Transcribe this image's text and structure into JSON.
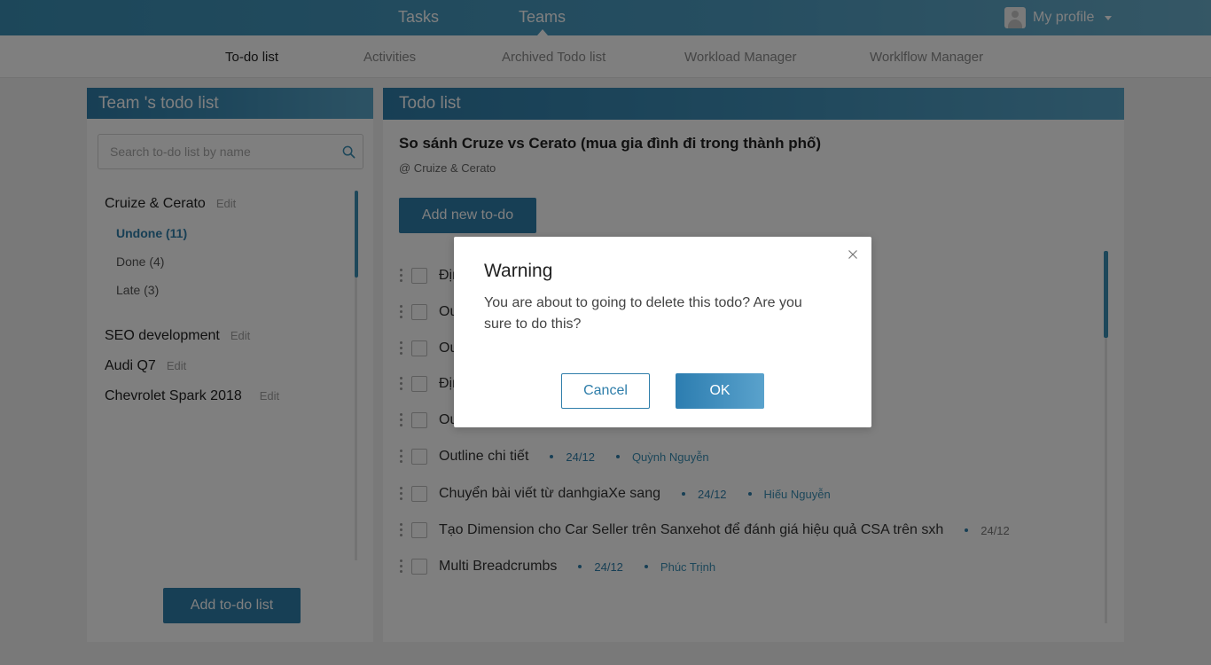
{
  "topbar": {
    "nav": [
      "Tasks",
      "Teams"
    ],
    "active": "Teams",
    "profile_label": "My profile"
  },
  "subnav": {
    "items": [
      "To-do list",
      "Activities",
      "Archived Todo list",
      "Workload Manager",
      "Worklflow Manager"
    ],
    "active": "To-do list"
  },
  "left_panel": {
    "header": "Team 's todo list",
    "search_placeholder": "Search to-do list by name",
    "groups": [
      {
        "name": "Cruize & Cerato",
        "edit": "Edit"
      },
      {
        "name": "SEO development",
        "edit": "Edit"
      },
      {
        "name": "Audi Q7",
        "edit": "Edit"
      },
      {
        "name": "Chevrolet Spark 2018",
        "edit": "Edit"
      }
    ],
    "filters": [
      "Undone (11)",
      "Done (4)",
      "Late (3)"
    ],
    "active_filter": "Undone (11)",
    "add_button": "Add to-do list"
  },
  "right_panel": {
    "header": "Todo list",
    "title": "So sánh Cruze vs Cerato (mua gia đình đi trong thành phố)",
    "subtitle": "@ Cruize & Cerato",
    "add_button": "Add new to-do",
    "todos": [
      {
        "title": "Địn",
        "due": "",
        "assignee": ""
      },
      {
        "title": "Ou",
        "due": "",
        "assignee": ""
      },
      {
        "title": "Ou",
        "due": "",
        "assignee": ""
      },
      {
        "title": "Địn",
        "due": "",
        "assignee": ""
      },
      {
        "title": "Ou",
        "due": "",
        "assignee": ""
      },
      {
        "title": "Outline chi tiết",
        "due": "24/12",
        "assignee": "Quỳnh Nguyễn"
      },
      {
        "title": "Chuyển bài viết từ danhgiaXe sang",
        "due": "24/12",
        "assignee": "Hiếu Nguyễn"
      },
      {
        "title": "Tạo Dimension cho Car Seller trên Sanxehot để đánh giá hiệu quả CSA trên sxh",
        "due": "24/12",
        "assignee": ""
      },
      {
        "title": "Multi Breadcrumbs",
        "due": "24/12",
        "assignee": "Phúc Trịnh"
      }
    ]
  },
  "modal": {
    "title": "Warning",
    "message": "You are about to going to delete this todo? Are you sure to do this?",
    "cancel": "Cancel",
    "ok": "OK"
  },
  "icons": {
    "search": "search-icon",
    "close": "close-icon",
    "avatar": "avatar-icon",
    "caret": "chevron-down-icon",
    "drag": "drag-handle-icon"
  },
  "colors": {
    "accent": "#2f7eaa",
    "topbar": "#3a8fb5",
    "overlay": "rgba(0,0,0,0.5)"
  }
}
